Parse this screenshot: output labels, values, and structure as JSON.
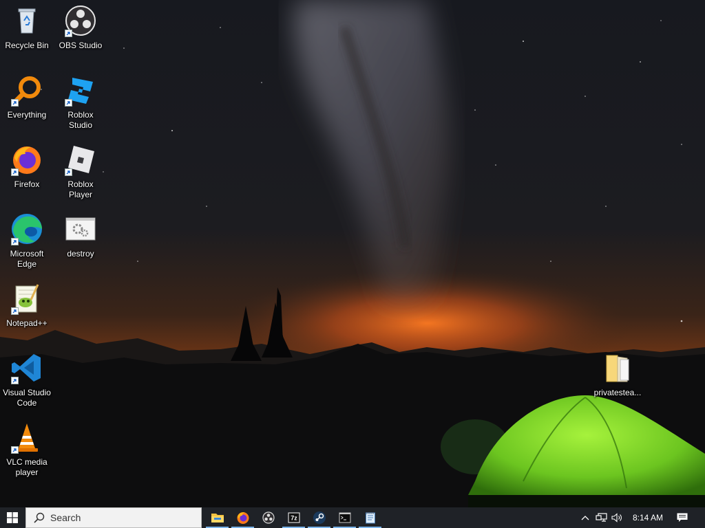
{
  "desktop": {
    "icons": [
      {
        "label": "Recycle Bin",
        "icon": "recycle-bin-icon"
      },
      {
        "label": "OBS Studio",
        "icon": "obs-studio-icon"
      },
      {
        "label": "Everything",
        "icon": "everything-search-icon"
      },
      {
        "label": "Roblox Studio",
        "icon": "roblox-studio-icon"
      },
      {
        "label": "Firefox",
        "icon": "firefox-icon"
      },
      {
        "label": "Roblox Player",
        "icon": "roblox-player-icon"
      },
      {
        "label": "Microsoft Edge",
        "icon": "edge-icon"
      },
      {
        "label": "destroy",
        "icon": "batch-file-icon"
      },
      {
        "label": "Notepad++",
        "icon": "notepadpp-icon"
      },
      {
        "label": "Visual Studio Code",
        "icon": "vscode-icon"
      },
      {
        "label": "VLC media player",
        "icon": "vlc-icon"
      },
      {
        "label": "privatestea...",
        "icon": "folder-icon"
      }
    ]
  },
  "taskbar": {
    "search_placeholder": "Search",
    "pinned": [
      {
        "name": "file-explorer",
        "icon": "folder-icon",
        "active": true
      },
      {
        "name": "firefox",
        "icon": "firefox-icon",
        "active": true
      },
      {
        "name": "obs-studio",
        "icon": "obs-studio-icon",
        "active": false
      },
      {
        "name": "7zip",
        "icon": "7zip-icon",
        "active": true
      },
      {
        "name": "steam",
        "icon": "steam-icon",
        "active": true
      },
      {
        "name": "command-prompt",
        "icon": "cmd-icon",
        "active": true
      },
      {
        "name": "notepad",
        "icon": "notepad-icon",
        "active": true
      }
    ],
    "clock": "8:14 AM"
  },
  "colors": {
    "taskbar_bg": "#1f2227",
    "active_indicator": "#7ab4ea",
    "tent": "#7ddb2a",
    "horizon_glow": "#e2661c"
  }
}
